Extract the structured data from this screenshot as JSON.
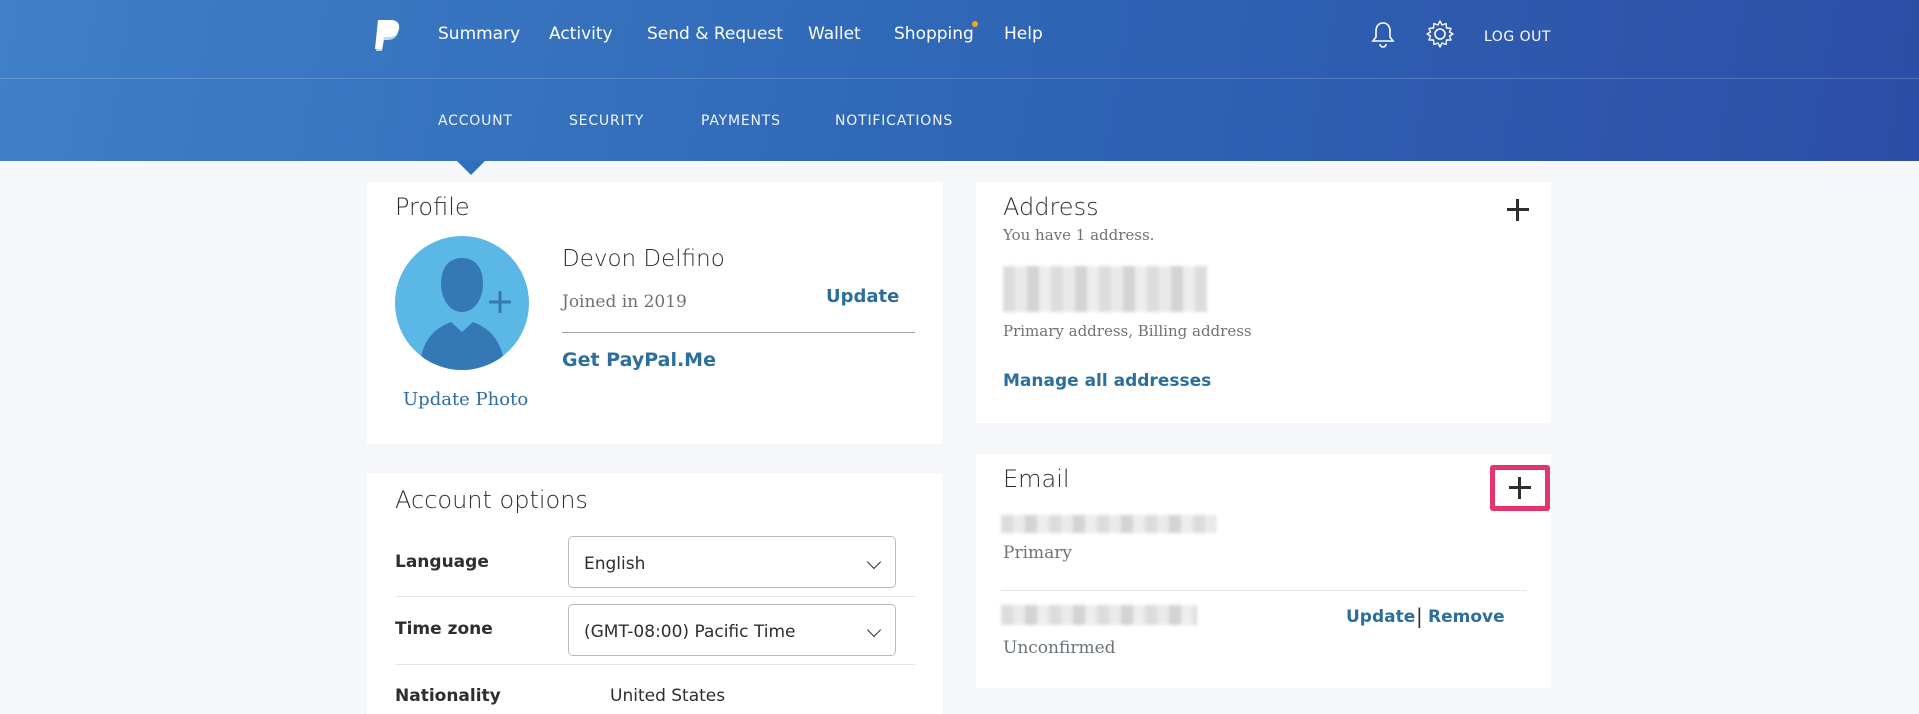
{
  "nav": {
    "items": [
      "Summary",
      "Activity",
      "Send & Request",
      "Wallet",
      "Shopping",
      "Help"
    ],
    "logout": "LOG OUT"
  },
  "subnav": {
    "items": [
      "ACCOUNT",
      "SECURITY",
      "PAYMENTS",
      "NOTIFICATIONS"
    ],
    "active": "ACCOUNT"
  },
  "profile": {
    "title": "Profile",
    "name": "Devon Delfino",
    "joined": "Joined in 2019",
    "update": "Update",
    "paypal_me": "Get PayPal.Me",
    "update_photo": "Update Photo"
  },
  "account_options": {
    "title": "Account options",
    "language_label": "Language",
    "language_value": "English",
    "timezone_label": "Time zone",
    "timezone_value": "(GMT-08:00) Pacific Time",
    "nationality_label": "Nationality",
    "nationality_value": "United States"
  },
  "address": {
    "title": "Address",
    "count_text": "You have 1 address.",
    "type_text": "Primary address, Billing address",
    "manage": "Manage all addresses"
  },
  "email": {
    "title": "Email",
    "primary_label": "Primary",
    "unconfirmed_label": "Unconfirmed",
    "update": "Update",
    "separator": "|",
    "remove": "Remove"
  },
  "colors": {
    "header_gradient_start": "#3f80c7",
    "header_gradient_end": "#2c4ea6",
    "link": "#2c6e9c",
    "highlight": "#e5336b",
    "avatar_bg": "#5bb7e6"
  },
  "icons": [
    "paypal-logo-icon",
    "bell-icon",
    "gear-icon",
    "plus-icon",
    "chevron-down-icon",
    "user-silhouette-icon"
  ]
}
